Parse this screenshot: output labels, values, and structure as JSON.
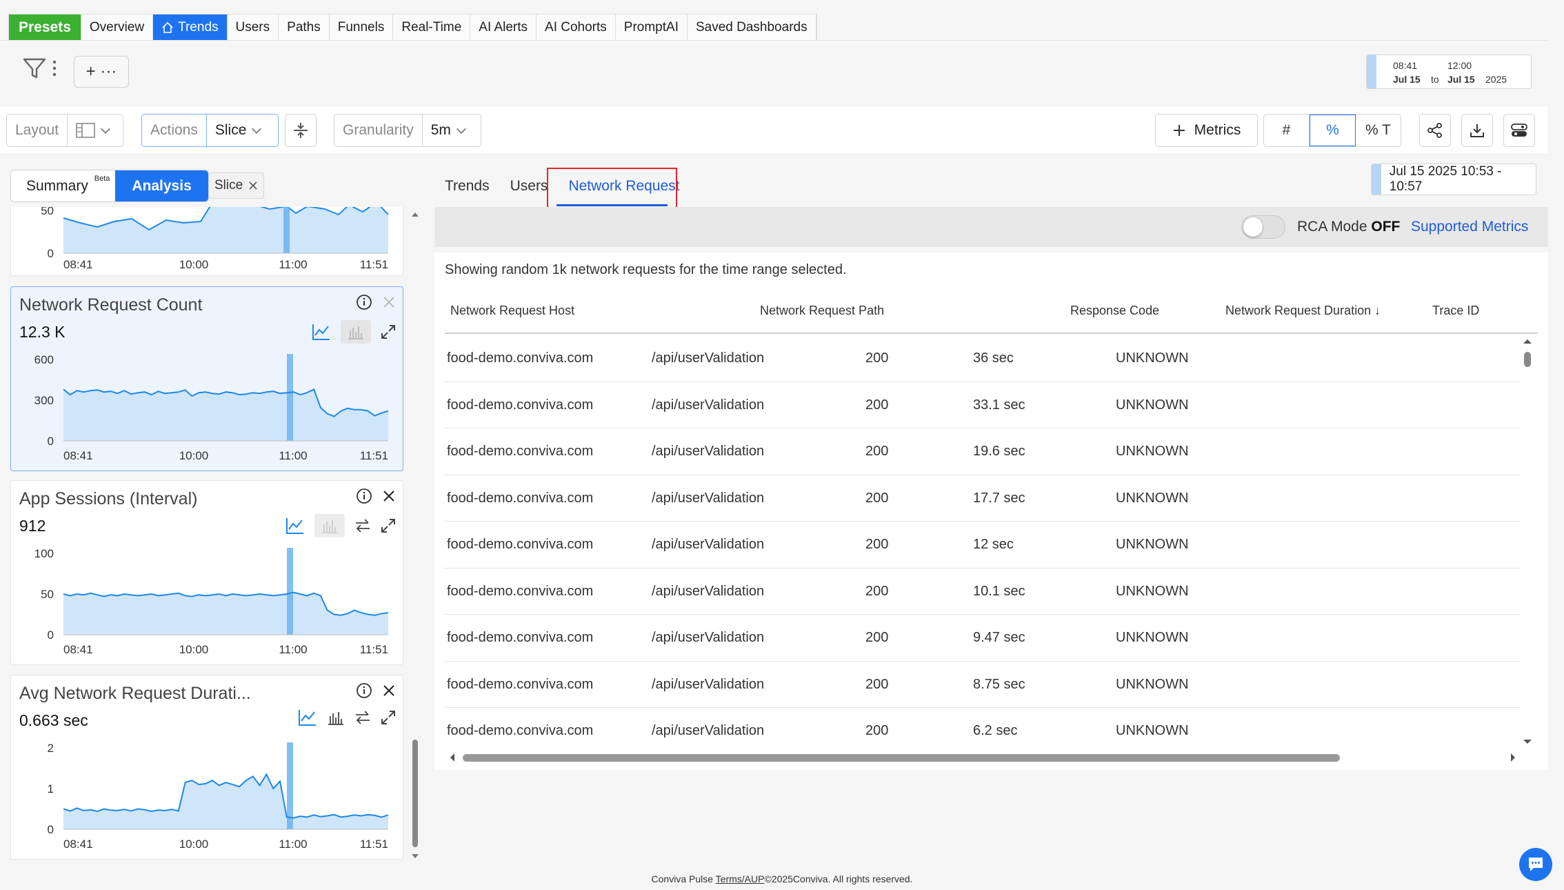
{
  "nav": {
    "presets": "Presets",
    "tabs": [
      "Overview",
      "Trends",
      "Users",
      "Paths",
      "Funnels",
      "Real-Time",
      "AI Alerts",
      "AI Cohorts",
      "PromptAI",
      "Saved Dashboards"
    ],
    "active": "Trends"
  },
  "add_button": "+ ···",
  "date_range": {
    "start_time": "08:41",
    "end_time": "12:00",
    "start_date": "Jul 15",
    "to": "to",
    "end_date": "Jul 15",
    "year": "2025"
  },
  "toolbar": {
    "layout_label": "Layout",
    "actions_label": "Actions",
    "actions_value": "Slice",
    "granularity_label": "Granularity",
    "granularity_value": "5m",
    "metrics_label": "Metrics",
    "toggle": [
      "#",
      "%",
      "% T"
    ],
    "toggle_selected": "%"
  },
  "left_panel": {
    "tabs": [
      "Summary",
      "Analysis"
    ],
    "summary_badge": "Beta",
    "active_tab": "Analysis",
    "chip": "Slice",
    "top_card": {
      "y_ticks": [
        "50",
        "0"
      ],
      "x_ticks": [
        "08:41",
        "10:00",
        "11:00",
        "11:51"
      ]
    },
    "cards": [
      {
        "title": "Network Request Count",
        "value": "12.3 K",
        "y_ticks": [
          "600",
          "300",
          "0"
        ],
        "x_ticks": [
          "08:41",
          "10:00",
          "11:00",
          "11:51"
        ]
      },
      {
        "title": "App Sessions (Interval)",
        "value": "912",
        "y_ticks": [
          "100",
          "50",
          "0"
        ],
        "x_ticks": [
          "08:41",
          "10:00",
          "11:00",
          "11:51"
        ]
      },
      {
        "title": "Avg Network Request Durati...",
        "value": "0.663 sec",
        "y_ticks": [
          "2",
          "1",
          "0"
        ],
        "x_ticks": [
          "08:41",
          "10:00",
          "11:00",
          "11:51"
        ]
      }
    ]
  },
  "chart_data": [
    {
      "type": "area",
      "title": "Network Request Count",
      "xlabel": "",
      "ylabel": "",
      "ylim": [
        0,
        600
      ],
      "x_ticks": [
        "08:41",
        "10:00",
        "11:00",
        "11:51"
      ],
      "values": [
        380,
        340,
        370,
        360,
        370,
        375,
        360,
        365,
        350,
        370,
        345,
        355,
        360,
        340,
        365,
        350,
        355,
        360,
        375,
        330,
        355,
        360,
        350,
        345,
        360,
        355,
        340,
        345,
        355,
        350,
        360,
        365,
        350,
        355,
        360,
        340,
        355,
        380,
        245,
        200,
        180,
        220,
        240,
        230,
        230,
        220,
        185,
        205,
        220
      ]
    },
    {
      "type": "area",
      "title": "App Sessions (Interval)",
      "xlabel": "",
      "ylabel": "",
      "ylim": [
        0,
        100
      ],
      "x_ticks": [
        "08:41",
        "10:00",
        "11:00",
        "11:51"
      ],
      "values": [
        50,
        48,
        50,
        49,
        51,
        49,
        47,
        49,
        48,
        50,
        49,
        48,
        49,
        50,
        48,
        49,
        50,
        51,
        48,
        47,
        49,
        48,
        49,
        50,
        48,
        50,
        49,
        48,
        49,
        50,
        49,
        48,
        49,
        50,
        52,
        50,
        48,
        51,
        48,
        30,
        25,
        24,
        26,
        30,
        27,
        25,
        24,
        26,
        27
      ]
    },
    {
      "type": "area",
      "title": "Avg Network Request Durati...",
      "xlabel": "",
      "ylabel": "",
      "ylim": [
        0,
        2
      ],
      "x_ticks": [
        "08:41",
        "10:00",
        "11:00",
        "11:51"
      ],
      "values": [
        0.5,
        0.45,
        0.52,
        0.46,
        0.48,
        0.44,
        0.5,
        0.47,
        0.46,
        0.49,
        0.45,
        0.5,
        0.48,
        0.44,
        0.47,
        0.46,
        0.49,
        0.45,
        1.15,
        1.2,
        1.1,
        1.12,
        1.2,
        1.08,
        1.15,
        1.1,
        1.05,
        1.2,
        1.3,
        1.08,
        1.35,
        1.0,
        1.18,
        0.3,
        0.28,
        0.32,
        0.3,
        0.35,
        0.31,
        0.33,
        0.36,
        0.3,
        0.32,
        0.35,
        0.33,
        0.36,
        0.34,
        0.3,
        0.35
      ]
    }
  ],
  "right_panel": {
    "tabs": [
      "Trends",
      "Users",
      "Network Request"
    ],
    "active_tab": "Network Request",
    "time_range": "Jul 15 2025 10:53 - 10:57",
    "rca_label": "RCA Mode",
    "rca_state": "OFF",
    "supported_metrics": "Supported Metrics",
    "note": "Showing random 1k network requests for the time range selected.",
    "columns": [
      "Network Request Host",
      "Network Request Path",
      "Response Code",
      "Network Request Duration",
      "Trace ID"
    ],
    "sort_arrow": "↓",
    "rows": [
      [
        "food-demo.conviva.com",
        "/api/userValidation",
        "200",
        "36 sec",
        "UNKNOWN"
      ],
      [
        "food-demo.conviva.com",
        "/api/userValidation",
        "200",
        "33.1 sec",
        "UNKNOWN"
      ],
      [
        "food-demo.conviva.com",
        "/api/userValidation",
        "200",
        "19.6 sec",
        "UNKNOWN"
      ],
      [
        "food-demo.conviva.com",
        "/api/userValidation",
        "200",
        "17.7 sec",
        "UNKNOWN"
      ],
      [
        "food-demo.conviva.com",
        "/api/userValidation",
        "200",
        "12 sec",
        "UNKNOWN"
      ],
      [
        "food-demo.conviva.com",
        "/api/userValidation",
        "200",
        "10.1 sec",
        "UNKNOWN"
      ],
      [
        "food-demo.conviva.com",
        "/api/userValidation",
        "200",
        "9.47 sec",
        "UNKNOWN"
      ],
      [
        "food-demo.conviva.com",
        "/api/userValidation",
        "200",
        "8.75 sec",
        "UNKNOWN"
      ],
      [
        "food-demo.conviva.com",
        "/api/userValidation",
        "200",
        "6.2 sec",
        "UNKNOWN"
      ]
    ]
  },
  "footer": {
    "brand": "Conviva Pulse",
    "terms": "Terms/AUP",
    "copyright": "©2025Conviva. All rights reserved."
  },
  "colors": {
    "accent": "#1e74f0",
    "presets": "#3bb031",
    "chart_line": "#1e88e5",
    "chart_fill": "#cfe5fa",
    "highlight": "#e0242b"
  }
}
